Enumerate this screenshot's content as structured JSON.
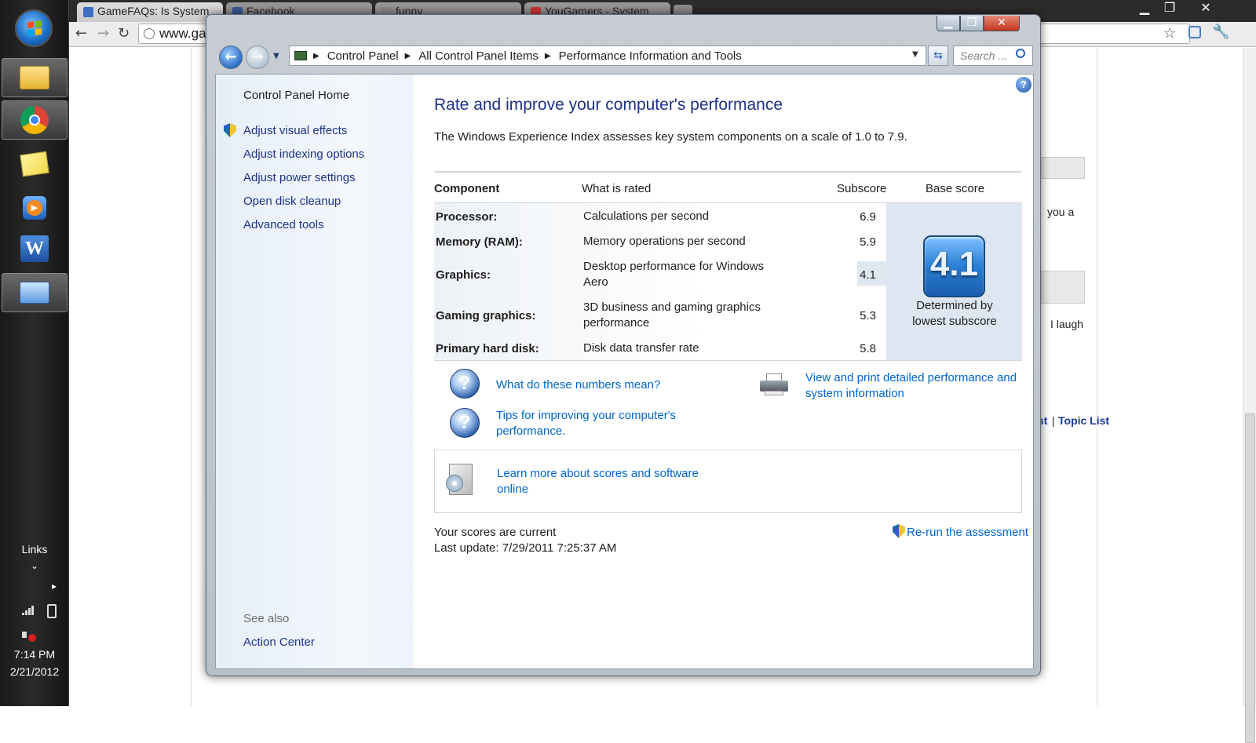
{
  "taskbar": {
    "links_label": "Links",
    "expand_glyph": "⌄",
    "arrow_glyph": "▸",
    "time": "7:14 PM",
    "date": "2/21/2012"
  },
  "browser": {
    "tabs": [
      {
        "label": "GameFAQs: Is System"
      },
      {
        "label": "Facebook"
      },
      {
        "label": "funny"
      },
      {
        "label": "YouGamers - System"
      }
    ],
    "url": "www.ga",
    "page_fragments": {
      "text1": "you a",
      "text2": "I laugh",
      "footer_link_prefix": "st",
      "footer_sep": "|",
      "footer_link": "Topic List"
    }
  },
  "window": {
    "breadcrumbs": [
      "Control Panel",
      "All Control Panel Items",
      "Performance Information and Tools"
    ],
    "search_placeholder": "Search ...",
    "help_glyph": "?"
  },
  "sidebar": {
    "home": "Control Panel Home",
    "items": [
      {
        "label": "Adjust visual effects"
      },
      {
        "label": "Adjust indexing options"
      },
      {
        "label": "Adjust power settings"
      },
      {
        "label": "Open disk cleanup"
      },
      {
        "label": "Advanced tools"
      }
    ],
    "see_also_label": "See also",
    "see_also_items": [
      {
        "label": "Action Center"
      }
    ]
  },
  "main": {
    "title": "Rate and improve your computer's performance",
    "description": "The Windows Experience Index assesses key system components on a scale of 1.0 to 7.9.",
    "table": {
      "headers": {
        "component": "Component",
        "rated": "What is rated",
        "subscore": "Subscore",
        "base": "Base score"
      },
      "rows": [
        {
          "component": "Processor:",
          "rated": "Calculations per second",
          "subscore": "6.9"
        },
        {
          "component": "Memory (RAM):",
          "rated": "Memory operations per second",
          "subscore": "5.9"
        },
        {
          "component": "Graphics:",
          "rated": "Desktop performance for Windows Aero",
          "subscore": "4.1"
        },
        {
          "component": "Gaming graphics:",
          "rated": "3D business and gaming graphics performance",
          "subscore": "5.3"
        },
        {
          "component": "Primary hard disk:",
          "rated": "Disk data transfer rate",
          "subscore": "5.8"
        }
      ],
      "base_score": "4.1",
      "base_caption": "Determined by lowest subscore"
    },
    "links": {
      "numbers": "What do these numbers mean?",
      "tips": "Tips for improving your computer's performance.",
      "print": "View and print detailed performance and system information",
      "learn_more": "Learn more about scores and software online"
    },
    "status": "Your scores are current",
    "last_update": "Last update: 7/29/2011 7:25:37 AM",
    "rerun": "Re-run the assessment"
  },
  "colors": {
    "link": "#0066cc",
    "title": "#1e3287",
    "score_tile": "#3a8ad6"
  }
}
